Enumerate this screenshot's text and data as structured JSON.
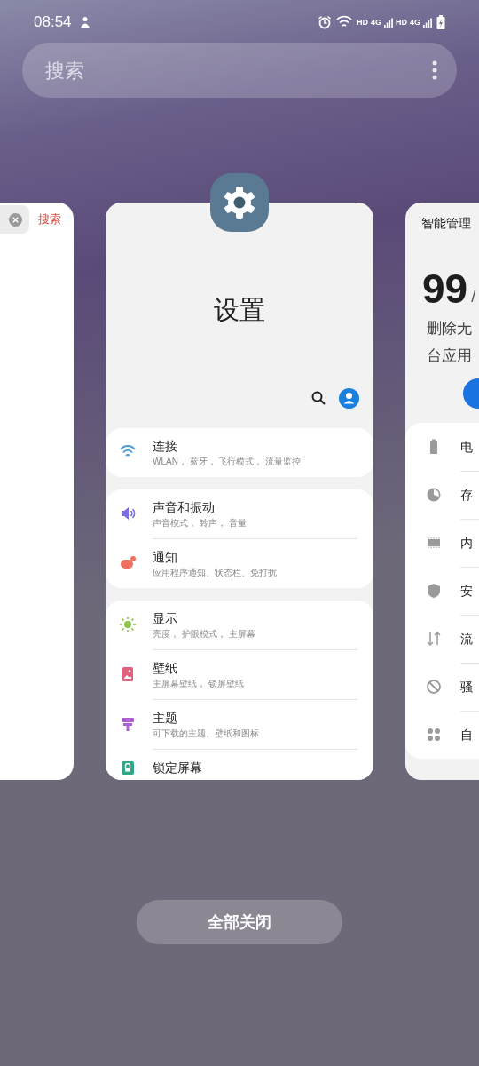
{
  "status_bar": {
    "time": "08:54",
    "indicators": [
      "HD",
      "4G",
      "HD",
      "4G"
    ]
  },
  "search": {
    "placeholder": "搜索"
  },
  "left_card": {
    "search_label": "搜索"
  },
  "settings_card": {
    "title": "设置",
    "groups": [
      {
        "items": [
          {
            "kind": "wifi",
            "color": "#4a9fdc",
            "title": "连接",
            "subtitle": "WLAN， 蓝牙， 飞行模式， 流量监控"
          }
        ]
      },
      {
        "items": [
          {
            "kind": "sound",
            "color": "#7b6fe0",
            "title": "声音和振动",
            "subtitle": "声音模式， 铃声， 音量"
          },
          {
            "kind": "notification",
            "color": "#ee7060",
            "title": "通知",
            "subtitle": "应用程序通知、状态栏、免打扰"
          }
        ]
      },
      {
        "items": [
          {
            "kind": "display",
            "color": "#8bc34a",
            "title": "显示",
            "subtitle": "亮度， 护眼模式， 主屏幕"
          },
          {
            "kind": "wallpaper",
            "color": "#e0607e",
            "title": "壁纸",
            "subtitle": "主屏幕壁纸， 锁屏壁纸"
          },
          {
            "kind": "theme",
            "color": "#b05ed8",
            "title": "主题",
            "subtitle": "可下载的主题、壁纸和图标"
          },
          {
            "kind": "lock",
            "color": "#2fa889",
            "title": "锁定屏幕"
          }
        ]
      }
    ]
  },
  "right_card": {
    "title": "智能管理",
    "score": "99",
    "score_suffix": "/",
    "lines": [
      "删除无",
      "台应用"
    ],
    "items": [
      {
        "kind": "battery",
        "label": "电"
      },
      {
        "kind": "storage",
        "label": "存"
      },
      {
        "kind": "memory",
        "label": "内"
      },
      {
        "kind": "security",
        "label": "安"
      },
      {
        "kind": "data",
        "label": "流"
      },
      {
        "kind": "block",
        "label": "骚"
      },
      {
        "kind": "auto",
        "label": "自"
      }
    ]
  },
  "close_all": "全部关闭"
}
